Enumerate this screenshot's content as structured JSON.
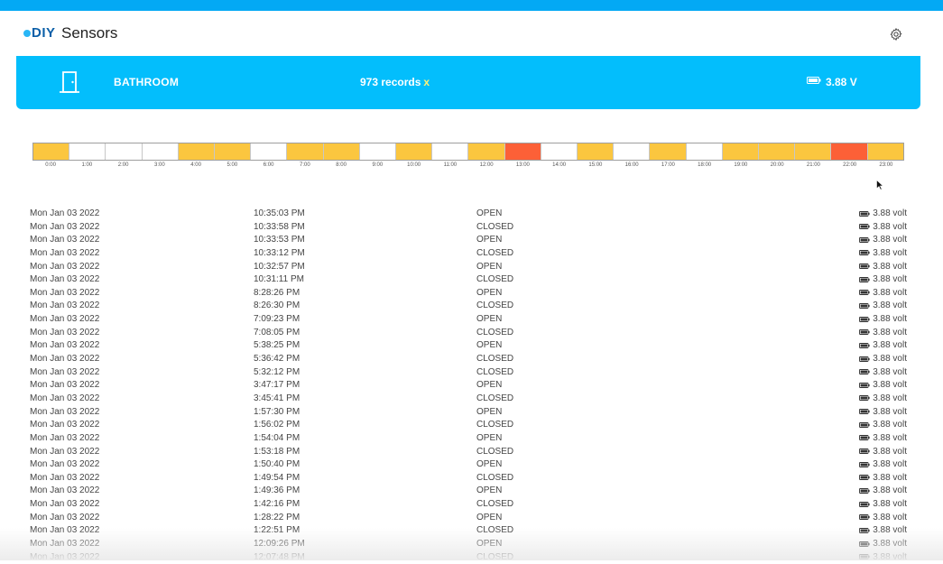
{
  "app": {
    "logo_text": "DIY",
    "title": "Sensors",
    "settings_icon": "gear-icon"
  },
  "banner": {
    "icon": "door-icon",
    "sensor_name": "BATHROOM",
    "records_label": "973 records",
    "records_clear": "x",
    "battery_icon": "battery-icon",
    "voltage": "3.88 V",
    "background": "#03befc"
  },
  "colors": {
    "active": "#fbc63f",
    "high": "#fc6037",
    "none": "#ffffff"
  },
  "timeline": {
    "hours": [
      {
        "label": "0:00",
        "level": "active"
      },
      {
        "label": "1:00",
        "level": "none"
      },
      {
        "label": "2:00",
        "level": "none"
      },
      {
        "label": "3:00",
        "level": "none"
      },
      {
        "label": "4:00",
        "level": "active"
      },
      {
        "label": "5:00",
        "level": "active"
      },
      {
        "label": "6:00",
        "level": "none"
      },
      {
        "label": "7:00",
        "level": "active"
      },
      {
        "label": "8:00",
        "level": "active"
      },
      {
        "label": "9:00",
        "level": "none"
      },
      {
        "label": "10:00",
        "level": "active"
      },
      {
        "label": "11:00",
        "level": "none"
      },
      {
        "label": "12:00",
        "level": "active"
      },
      {
        "label": "13:00",
        "level": "high"
      },
      {
        "label": "14:00",
        "level": "none"
      },
      {
        "label": "15:00",
        "level": "active"
      },
      {
        "label": "16:00",
        "level": "none"
      },
      {
        "label": "17:00",
        "level": "active"
      },
      {
        "label": "18:00",
        "level": "none"
      },
      {
        "label": "19:00",
        "level": "active"
      },
      {
        "label": "20:00",
        "level": "active"
      },
      {
        "label": "21:00",
        "level": "active"
      },
      {
        "label": "22:00",
        "level": "high"
      },
      {
        "label": "23:00",
        "level": "active"
      }
    ]
  },
  "records": [
    {
      "date": "Mon Jan 03 2022",
      "time": "10:35:03 PM",
      "state": "OPEN",
      "voltage": "3.88 volt"
    },
    {
      "date": "Mon Jan 03 2022",
      "time": "10:33:58 PM",
      "state": "CLOSED",
      "voltage": "3.88 volt"
    },
    {
      "date": "Mon Jan 03 2022",
      "time": "10:33:53 PM",
      "state": "OPEN",
      "voltage": "3.88 volt"
    },
    {
      "date": "Mon Jan 03 2022",
      "time": "10:33:12 PM",
      "state": "CLOSED",
      "voltage": "3.88 volt"
    },
    {
      "date": "Mon Jan 03 2022",
      "time": "10:32:57 PM",
      "state": "OPEN",
      "voltage": "3.88 volt"
    },
    {
      "date": "Mon Jan 03 2022",
      "time": "10:31:11 PM",
      "state": "CLOSED",
      "voltage": "3.88 volt"
    },
    {
      "date": "Mon Jan 03 2022",
      "time": "8:28:26 PM",
      "state": "OPEN",
      "voltage": "3.88 volt"
    },
    {
      "date": "Mon Jan 03 2022",
      "time": "8:26:30 PM",
      "state": "CLOSED",
      "voltage": "3.88 volt"
    },
    {
      "date": "Mon Jan 03 2022",
      "time": "7:09:23 PM",
      "state": "OPEN",
      "voltage": "3.88 volt"
    },
    {
      "date": "Mon Jan 03 2022",
      "time": "7:08:05 PM",
      "state": "CLOSED",
      "voltage": "3.88 volt"
    },
    {
      "date": "Mon Jan 03 2022",
      "time": "5:38:25 PM",
      "state": "OPEN",
      "voltage": "3.88 volt"
    },
    {
      "date": "Mon Jan 03 2022",
      "time": "5:36:42 PM",
      "state": "CLOSED",
      "voltage": "3.88 volt"
    },
    {
      "date": "Mon Jan 03 2022",
      "time": "5:32:12 PM",
      "state": "CLOSED",
      "voltage": "3.88 volt"
    },
    {
      "date": "Mon Jan 03 2022",
      "time": "3:47:17 PM",
      "state": "OPEN",
      "voltage": "3.88 volt"
    },
    {
      "date": "Mon Jan 03 2022",
      "time": "3:45:41 PM",
      "state": "CLOSED",
      "voltage": "3.88 volt"
    },
    {
      "date": "Mon Jan 03 2022",
      "time": "1:57:30 PM",
      "state": "OPEN",
      "voltage": "3.88 volt"
    },
    {
      "date": "Mon Jan 03 2022",
      "time": "1:56:02 PM",
      "state": "CLOSED",
      "voltage": "3.88 volt"
    },
    {
      "date": "Mon Jan 03 2022",
      "time": "1:54:04 PM",
      "state": "OPEN",
      "voltage": "3.88 volt"
    },
    {
      "date": "Mon Jan 03 2022",
      "time": "1:53:18 PM",
      "state": "CLOSED",
      "voltage": "3.88 volt"
    },
    {
      "date": "Mon Jan 03 2022",
      "time": "1:50:40 PM",
      "state": "OPEN",
      "voltage": "3.88 volt"
    },
    {
      "date": "Mon Jan 03 2022",
      "time": "1:49:54 PM",
      "state": "CLOSED",
      "voltage": "3.88 volt"
    },
    {
      "date": "Mon Jan 03 2022",
      "time": "1:49:36 PM",
      "state": "OPEN",
      "voltage": "3.88 volt"
    },
    {
      "date": "Mon Jan 03 2022",
      "time": "1:42:16 PM",
      "state": "CLOSED",
      "voltage": "3.88 volt"
    },
    {
      "date": "Mon Jan 03 2022",
      "time": "1:28:22 PM",
      "state": "OPEN",
      "voltage": "3.88 volt"
    },
    {
      "date": "Mon Jan 03 2022",
      "time": "1:22:51 PM",
      "state": "CLOSED",
      "voltage": "3.88 volt"
    },
    {
      "date": "Mon Jan 03 2022",
      "time": "12:09:26 PM",
      "state": "OPEN",
      "voltage": "3.88 volt"
    },
    {
      "date": "Mon Jan 03 2022",
      "time": "12:07:48 PM",
      "state": "CLOSED",
      "voltage": "3.88 volt"
    }
  ]
}
